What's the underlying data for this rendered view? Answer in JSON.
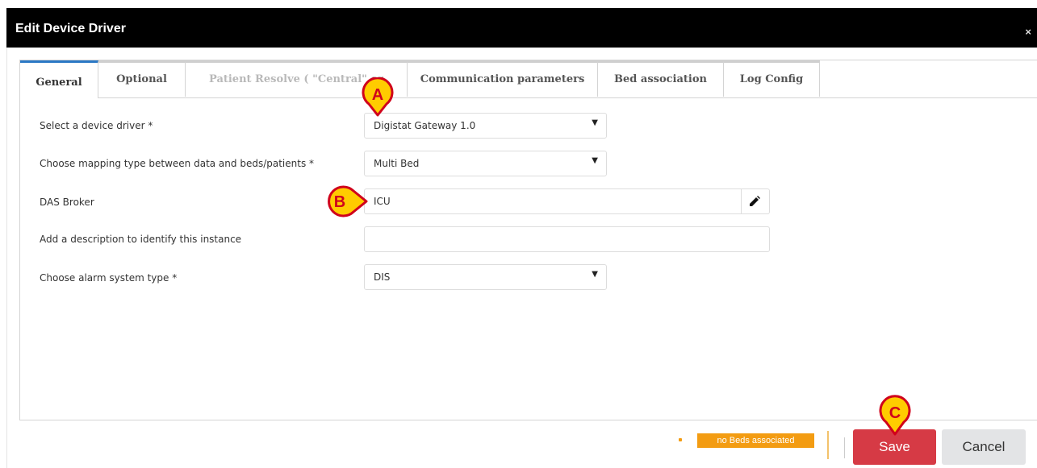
{
  "dialog": {
    "title": "Edit Device Driver",
    "close_glyph": "×"
  },
  "tabs": [
    {
      "label": "General",
      "state": "active"
    },
    {
      "label": "Optional",
      "state": "normal"
    },
    {
      "label": "Patient Resolve ( \"Central\" or",
      "state": "disabled"
    },
    {
      "label": "Communication parameters",
      "state": "normal"
    },
    {
      "label": "Bed association",
      "state": "normal"
    },
    {
      "label": "Log Config",
      "state": "normal"
    }
  ],
  "form": {
    "device_driver": {
      "label": "Select a device driver *",
      "value": "Digistat Gateway 1.0"
    },
    "mapping_type": {
      "label": "Choose mapping type between data and beds/patients *",
      "value": "Multi Bed"
    },
    "das_broker": {
      "label": "DAS Broker",
      "value": "ICU",
      "edit_icon": "pencil-icon"
    },
    "description": {
      "label": "Add a description to identify this instance",
      "value": ""
    },
    "alarm_system": {
      "label": "Choose alarm system type *",
      "value": "DIS"
    }
  },
  "markers": {
    "a": "A",
    "b": "B",
    "c": "C"
  },
  "footer": {
    "beds_status": "no Beds associated",
    "save_label": "Save",
    "cancel_label": "Cancel"
  },
  "colors": {
    "active_tab": "#2b78c5",
    "save": "#d63a45",
    "warning": "#f39c12",
    "marker": "#ffcc00",
    "marker_border": "#d0021b"
  }
}
